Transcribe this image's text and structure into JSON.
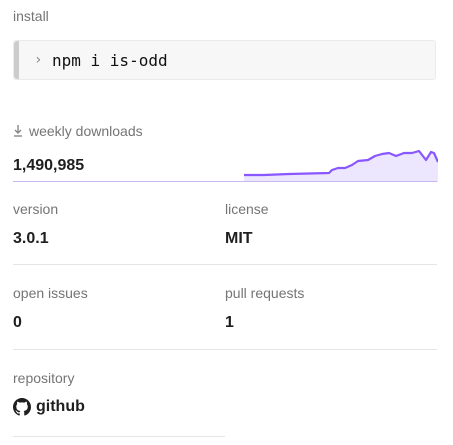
{
  "install": {
    "label": "install",
    "prompt": "›",
    "command": "npm i is-odd"
  },
  "downloads": {
    "label": "weekly downloads",
    "icon": "download-icon",
    "value": "1,490,985",
    "accent": "#8956ff",
    "fill": "#ede6ff"
  },
  "version": {
    "label": "version",
    "value": "3.0.1"
  },
  "license": {
    "label": "license",
    "value": "MIT"
  },
  "issues": {
    "label": "open issues",
    "value": "0"
  },
  "pulls": {
    "label": "pull requests",
    "value": "1"
  },
  "repository": {
    "label": "repository",
    "icon": "github-icon",
    "value": "github"
  }
}
